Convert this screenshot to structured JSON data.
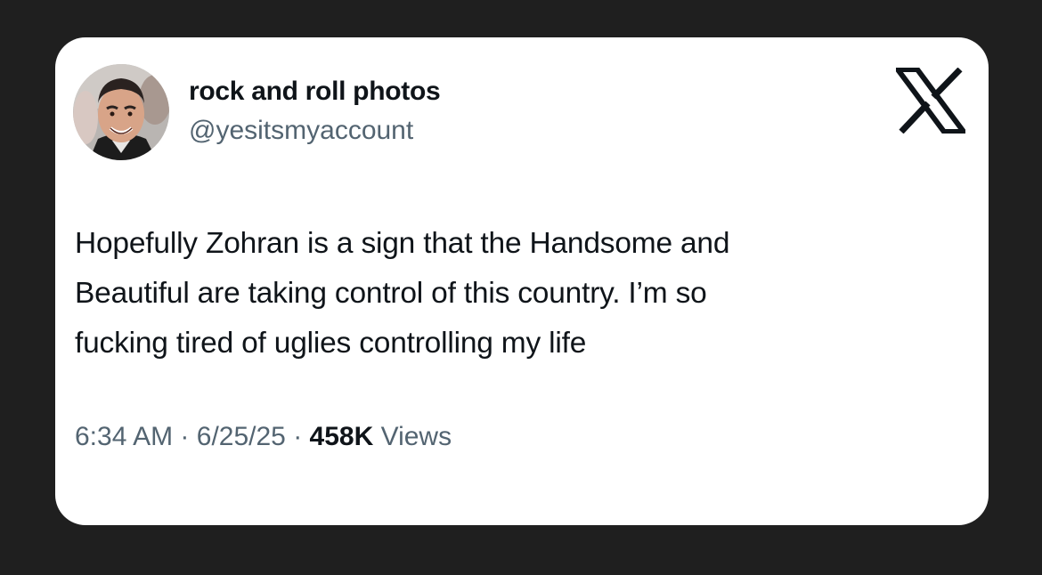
{
  "author": {
    "display_name": "rock and roll photos",
    "handle": "@yesitsmyaccount",
    "avatar": "profile-photo"
  },
  "brand_icon": "x-logo-icon",
  "tweet": {
    "lines": [
      "Hopefully Zohran is a sign that the Handsome and",
      "Beautiful are taking control of this country. I’m so",
      "fucking tired of uglies controlling my life"
    ]
  },
  "meta": {
    "time": "6:34 AM",
    "separator": "·",
    "date": "6/25/25",
    "views_count": "458K",
    "views_label": "Views"
  },
  "colors": {
    "background": "#1f1f1f",
    "card": "#ffffff",
    "text_primary": "#0f1419",
    "text_secondary": "#536471"
  }
}
